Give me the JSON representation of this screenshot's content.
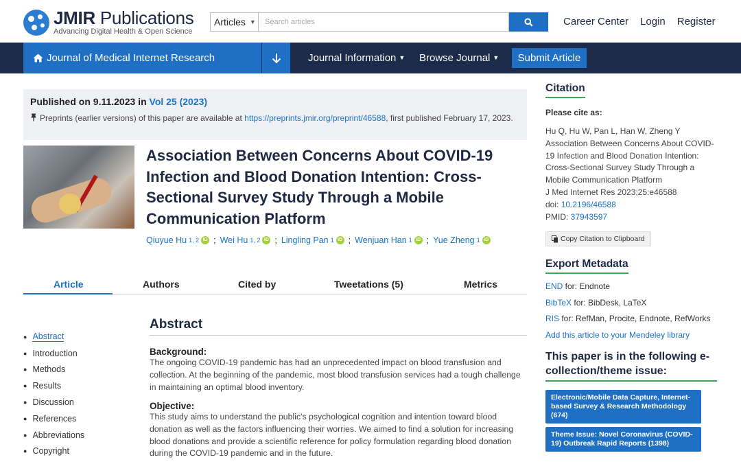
{
  "header": {
    "logo_bold": "JMIR",
    "logo_rest": " Publications",
    "logo_sub": "Advancing Digital Health & Open Science",
    "search_scope": "Articles",
    "search_placeholder": "Search articles",
    "links": [
      "Career Center",
      "Login",
      "Register"
    ]
  },
  "nav": {
    "journal": "Journal of Medical Internet Research",
    "items": [
      "Journal Information",
      "Browse Journal"
    ],
    "submit": "Submit Article"
  },
  "published": {
    "prefix": "Published on 9.11.2023 in ",
    "volume": "Vol 25 (2023)",
    "preprint_pre": "Preprints (earlier versions) of this paper are available at ",
    "preprint_url": "https://preprints.jmir.org/preprint/46588",
    "preprint_post": ", first published February 17, 2023."
  },
  "article": {
    "title": "Association Between Concerns About COVID-19 Infection and Blood Donation Intention: Cross-Sectional Survey Study Through a Mobile Communication Platform",
    "authors": [
      {
        "name": "Qiuyue Hu",
        "aff": "1, 2"
      },
      {
        "name": "Wei Hu",
        "aff": "1, 2"
      },
      {
        "name": "Lingling Pan",
        "aff": "1"
      },
      {
        "name": "Wenjuan Han",
        "aff": "1"
      },
      {
        "name": "Yue Zheng",
        "aff": "1"
      }
    ]
  },
  "tabs": [
    "Article",
    "Authors",
    "Cited by",
    "Tweetations (5)",
    "Metrics"
  ],
  "toc": [
    "Abstract",
    "Introduction",
    "Methods",
    "Results",
    "Discussion",
    "References",
    "Abbreviations",
    "Copyright"
  ],
  "abstract": {
    "title": "Abstract",
    "background_h": "Background:",
    "background": "The ongoing COVID-19 pandemic has had an unprecedented impact on blood transfusion and collection. At the beginning of the pandemic, most blood transfusion services had a tough challenge in maintaining an optimal blood inventory.",
    "objective_h": "Objective:",
    "objective": "This study aims to understand the public's psychological cognition and intention toward blood donation as well as the factors influencing their worries. We aimed to find a solution for increasing blood donations and provide a scientific reference for policy formulation regarding blood donation during the COVID-19 pandemic and in the future."
  },
  "citation": {
    "title": "Citation",
    "label": "Please cite as:",
    "text": "Hu Q, Hu W, Pan L, Han W, Zheng Y\nAssociation Between Concerns About COVID-19 Infection and Blood Donation Intention: Cross-Sectional Survey Study Through a Mobile Communication Platform",
    "journal_ref": "J Med Internet Res 2023;25:e46588",
    "doi_label": "doi: ",
    "doi": "10.2196/46588",
    "pmid_label": "PMID: ",
    "pmid": "37943597",
    "copy_btn": "Copy Citation to Clipboard"
  },
  "export": {
    "title": "Export Metadata",
    "rows": [
      {
        "link": "END",
        "text": " for: Endnote"
      },
      {
        "link": "BibTeX",
        "text": " for: BibDesk, LaTeX"
      },
      {
        "link": "RIS",
        "text": " for: RefMan, Procite, Endnote, RefWorks"
      }
    ],
    "mendeley": "Add this article to your Mendeley library"
  },
  "ecollection": {
    "title": "This paper is in the following e-collection/theme issue:",
    "items": [
      "Electronic/Mobile Data Capture, Internet-based Survey & Research Methodology (674)",
      "Theme Issue: Novel Coronavirus (COVID-19) Outbreak Rapid Reports (1398)"
    ]
  }
}
